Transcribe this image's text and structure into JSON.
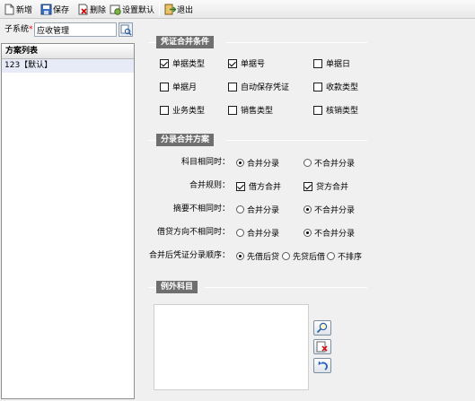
{
  "toolbar": {
    "buttons": [
      {
        "label": "新增",
        "icon": "new-document-icon"
      },
      {
        "label": "保存",
        "icon": "save-disk-icon"
      },
      {
        "label": "删除",
        "icon": "delete-icon"
      },
      {
        "label": "设置默认",
        "icon": "set-default-icon"
      },
      {
        "label": "退出",
        "icon": "exit-icon"
      }
    ]
  },
  "subsystem": {
    "label": "子系统",
    "required_mark": "*",
    "value": "应收管理"
  },
  "scheme_list": {
    "header": "方案列表",
    "items": [
      "123【默认】"
    ]
  },
  "voucher_merge": {
    "title": "凭证合并条件",
    "options": [
      {
        "label": "单据类型",
        "checked": true
      },
      {
        "label": "单据号",
        "checked": true
      },
      {
        "label": "单据日",
        "checked": false
      },
      {
        "label": "单据月",
        "checked": false
      },
      {
        "label": "自动保存凭证",
        "checked": false
      },
      {
        "label": "收款类型",
        "checked": false
      },
      {
        "label": "业务类型",
        "checked": false
      },
      {
        "label": "销售类型",
        "checked": false
      },
      {
        "label": "核销类型",
        "checked": false
      }
    ]
  },
  "entry_merge": {
    "title": "分录合并方案",
    "rows": [
      {
        "label": "科目相同时：",
        "options": [
          {
            "label": "合并分录",
            "selected": true
          },
          {
            "label": "不合并分录",
            "selected": false
          }
        ]
      },
      {
        "label": "合并规则：",
        "options": [
          {
            "label": "借方合并",
            "checked": true
          },
          {
            "label": "贷方合并",
            "checked": true
          }
        ]
      },
      {
        "label": "摘要不相同时：",
        "options": [
          {
            "label": "合并分录",
            "selected": false
          },
          {
            "label": "不合并分录",
            "selected": true
          }
        ]
      },
      {
        "label": "借贷方向不相同时：",
        "options": [
          {
            "label": "合并分录",
            "selected": false
          },
          {
            "label": "不合并分录",
            "selected": true
          }
        ]
      },
      {
        "label": "合并后凭证分录顺序：",
        "options": [
          {
            "label": "先借后贷",
            "selected": true
          },
          {
            "label": "先贷后借",
            "selected": false
          },
          {
            "label": "不排序",
            "selected": false
          }
        ]
      }
    ]
  },
  "exception_subjects": {
    "title": "例外科目",
    "buttons": [
      {
        "icon": "search-lookup-icon"
      },
      {
        "icon": "delete-row-icon"
      },
      {
        "icon": "undo-icon"
      }
    ]
  }
}
